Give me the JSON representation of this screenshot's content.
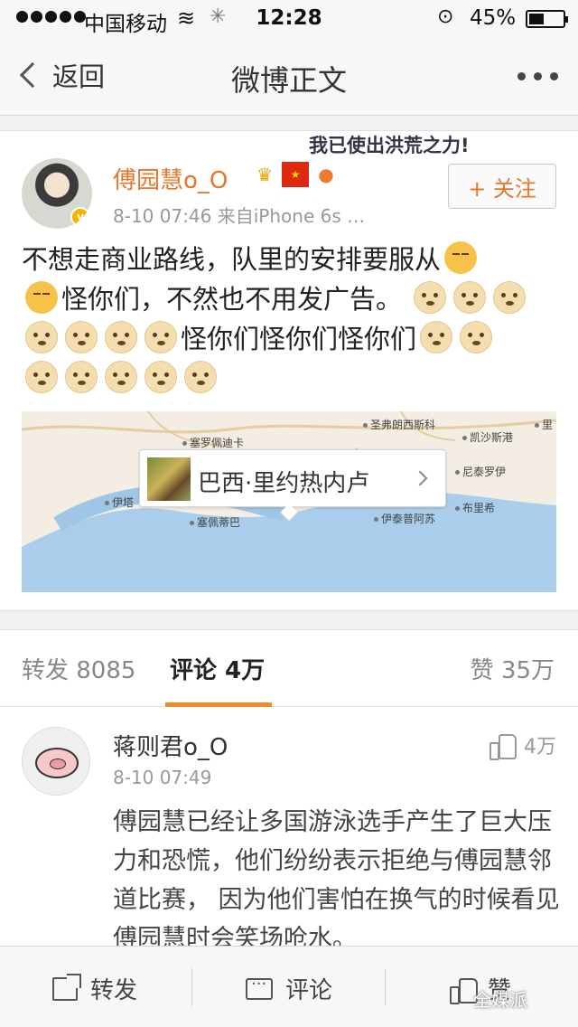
{
  "status_bar": {
    "carrier": "中国移动",
    "time": "12:28",
    "battery_text": "45%",
    "battery_level": 0.45
  },
  "nav": {
    "back_label": "返回",
    "title": "微博正文"
  },
  "post": {
    "username": "傅园慧o_O",
    "meta": "8-10 07:46  来自iPhone 6s …",
    "slogan": "我已使出洪荒之力!",
    "follow_label": "+ 关注",
    "text_1": "不想走商业路线，队里的安排要服从",
    "text_2": "怪你们，不然也不用发广告。",
    "text_3": "怪你们怪你们怪你们",
    "location": {
      "name": "巴西·里约热内卢",
      "map_labels": {
        "a": "圣弗朗西斯科",
        "b": "塞罗佩迪卡",
        "c": "凯沙斯港",
        "d": "里",
        "e": "伊塔",
        "f": "塞佩蒂巴",
        "g": "尼泰罗伊",
        "h": "伊泰普阿苏",
        "i": "布里希"
      }
    },
    "icons": [
      "sad-emoji",
      "doge-emoji",
      "crown-icon",
      "china-flag-icon",
      "balloon-icon",
      "verified-badge"
    ]
  },
  "tabs": {
    "repost": "转发 8085",
    "comments": "评论 4万",
    "likes": "赞 35万"
  },
  "comment": {
    "name": "蒋则君o_O",
    "time": "8-10 07:49",
    "likes": "4万",
    "text": "傅园慧已经让多国游泳选手产生了巨大压力和恐慌，他们纷纷表示拒绝与傅园慧邻道比赛， 因为他们害怕在换气的时候看见傅园慧时会笑场呛水。"
  },
  "toolbar": {
    "repost": "转发",
    "comment": "评论",
    "like": "赞"
  },
  "watermark": "全媒派",
  "colors": {
    "accent": "#e8762a",
    "tab_underline": "#f28a2a"
  }
}
